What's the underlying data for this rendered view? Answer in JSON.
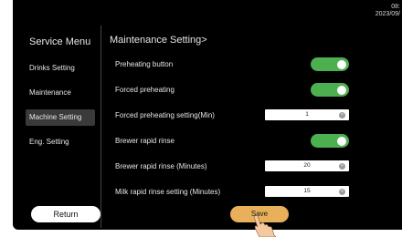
{
  "clock": {
    "time": "08:",
    "date": "2023/09/"
  },
  "sidebar": {
    "title": "Service Menu",
    "items": [
      {
        "label": "Drinks Setting"
      },
      {
        "label": "Maintenance"
      },
      {
        "label": "Machine Setting",
        "active": true
      },
      {
        "label": "Eng. Setting"
      }
    ],
    "return_label": "Return"
  },
  "main": {
    "title": "Maintenance Setting>",
    "rows": [
      {
        "label": "Preheating button",
        "type": "toggle",
        "on": true
      },
      {
        "label": "Forced preheating",
        "type": "toggle",
        "on": true
      },
      {
        "label": "Forced preheating setting(Min)",
        "type": "number",
        "value": "1"
      },
      {
        "label": "Brewer rapid rinse",
        "type": "toggle",
        "on": true
      },
      {
        "label": "Brewer rapid rinse (Minutes)",
        "type": "number",
        "value": "20"
      },
      {
        "label": "Milk rapid rinse setting (Minutes)",
        "type": "number",
        "value": "15"
      }
    ],
    "save_label": "Save"
  },
  "colors": {
    "toggle_on": "#4caf50",
    "save_button": "#e8b05a",
    "background": "#000000"
  },
  "icons": {
    "clear": "clear-circle-icon",
    "hand": "hand-pointer-icon"
  }
}
